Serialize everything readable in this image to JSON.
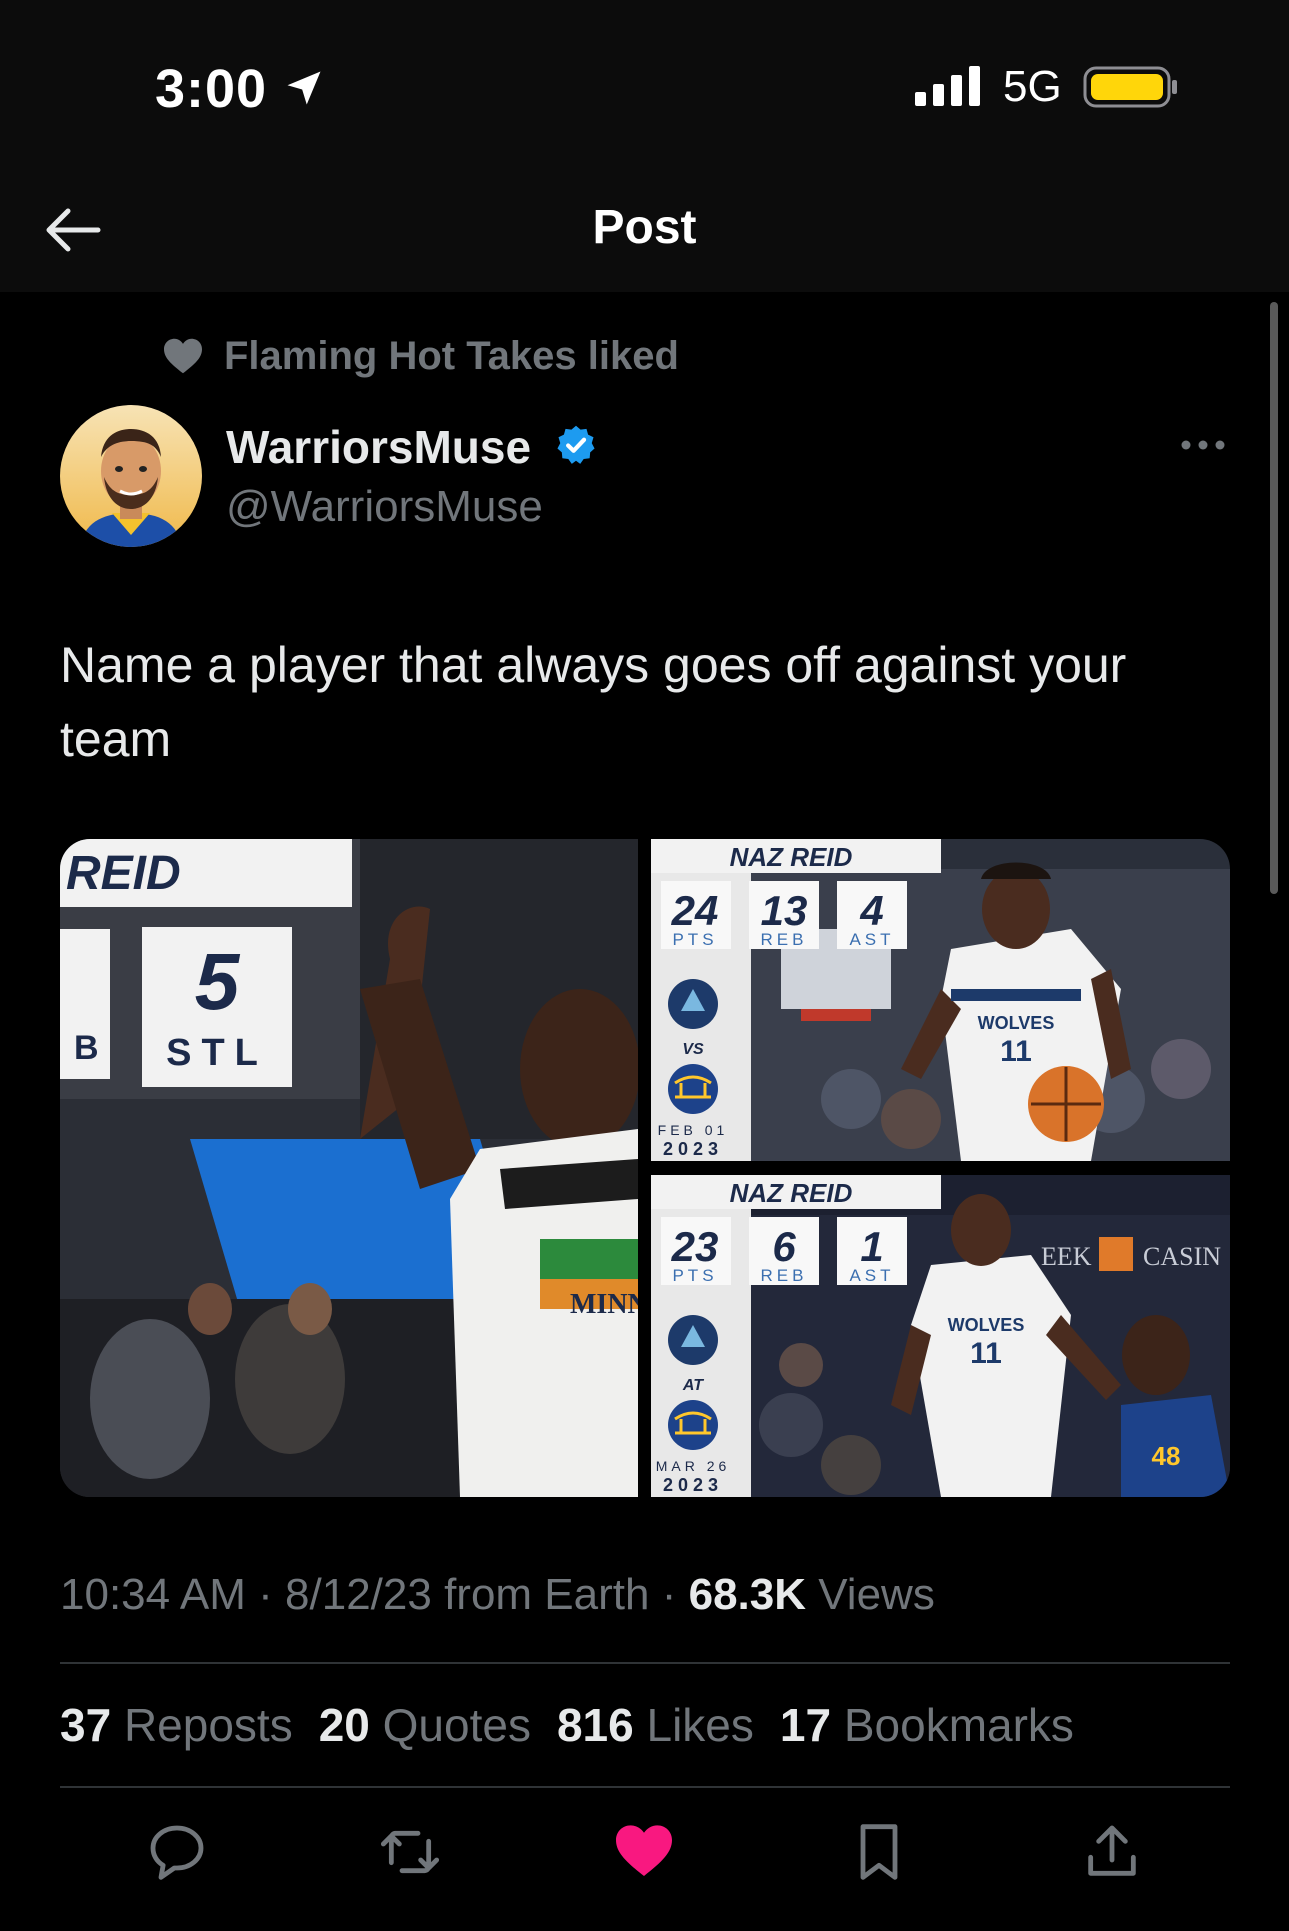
{
  "status_bar": {
    "time": "3:00",
    "network": "5G"
  },
  "header": {
    "title": "Post"
  },
  "post": {
    "social_context": "Flaming Hot Takes liked",
    "author": {
      "display_name": "WarriorsMuse",
      "handle": "@WarriorsMuse",
      "verified": true
    },
    "text": "Name a player that always goes off against your team",
    "media": {
      "left": {
        "name_banner": "REID",
        "stat_value": "5",
        "stat_label": "STL",
        "partial_label": "B",
        "jersey_text": "MINN"
      },
      "top_right": {
        "player": "NAZ REID",
        "stats": [
          {
            "value": "24",
            "label": "PTS"
          },
          {
            "value": "13",
            "label": "REB"
          },
          {
            "value": "4",
            "label": "AST"
          }
        ],
        "connector": "VS",
        "date_line1": "FEB 01",
        "date_line2": "2023",
        "jersey": "WOLVES",
        "number": "11"
      },
      "bottom_right": {
        "player": "NAZ REID",
        "stats": [
          {
            "value": "23",
            "label": "PTS"
          },
          {
            "value": "6",
            "label": "REB"
          },
          {
            "value": "1",
            "label": "AST"
          }
        ],
        "connector": "AT",
        "date_line1": "MAR 26",
        "date_line2": "2023",
        "jersey": "WOLVES",
        "number": "11",
        "background_sign": "EEK",
        "background_sign2": "CASIN"
      }
    },
    "timestamp": "10:34 AM",
    "date": "8/12/23",
    "source": "from Earth",
    "views_count": "68.3K",
    "views_label": "Views",
    "sep": "·",
    "stats": {
      "reposts": {
        "count": "37",
        "label": "Reposts"
      },
      "quotes": {
        "count": "20",
        "label": "Quotes"
      },
      "likes": {
        "count": "816",
        "label": "Likes"
      },
      "bookmarks": {
        "count": "17",
        "label": "Bookmarks"
      }
    },
    "liked": true
  },
  "colors": {
    "background": "#000000",
    "text": "#e7e9ea",
    "secondary": "#71767b",
    "divider": "#2f3336",
    "verified": "#1d9bf0",
    "like": "#f91880",
    "battery": "#ffd60a"
  },
  "icons": [
    "location-arrow-icon",
    "signal-icon",
    "battery-icon",
    "back-arrow-icon",
    "heart-icon",
    "verified-badge-icon",
    "more-icon",
    "reply-icon",
    "repost-icon",
    "like-icon",
    "bookmark-icon",
    "share-icon"
  ]
}
